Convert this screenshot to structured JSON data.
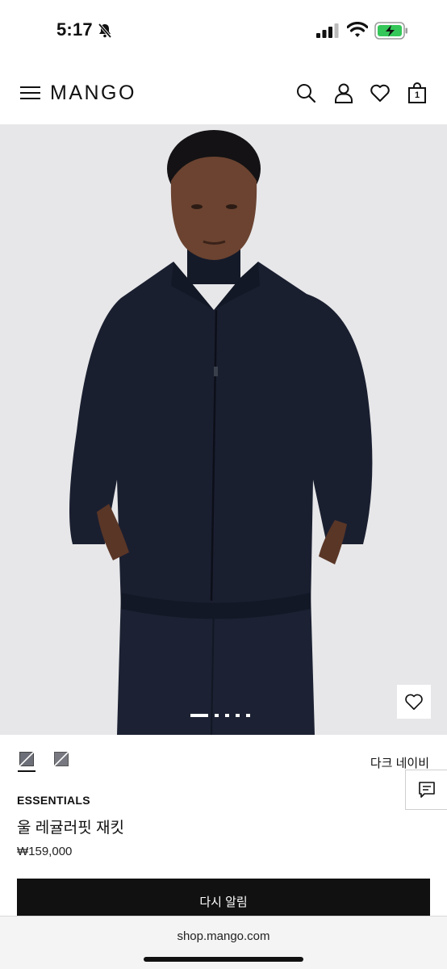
{
  "status_bar": {
    "time": "5:17",
    "icons": [
      "bell-muted-icon",
      "signal-icon",
      "wifi-icon",
      "battery-charging-icon"
    ],
    "battery_color": "#35c759"
  },
  "header": {
    "brand": "MANGO",
    "icons": [
      "menu-icon",
      "search-icon",
      "user-icon",
      "heart-icon",
      "bag-icon"
    ],
    "bag_count": "1"
  },
  "gallery": {
    "image": "model wearing dark navy wool zip jacket over turtleneck",
    "total_images": 5,
    "current_image": 1
  },
  "product": {
    "colors": [
      "swatch-1",
      "swatch-2"
    ],
    "selected_color_name": "다크 네이비",
    "collection": "ESSENTIALS",
    "name": "울 레귤러핏 재킷",
    "price": "₩159,000",
    "cta_label": "다시 알림"
  },
  "browser": {
    "url": "shop.mango.com"
  },
  "colors": {
    "jacket": "#1a1f30",
    "background": "#e7e7e9",
    "button": "#111111"
  }
}
